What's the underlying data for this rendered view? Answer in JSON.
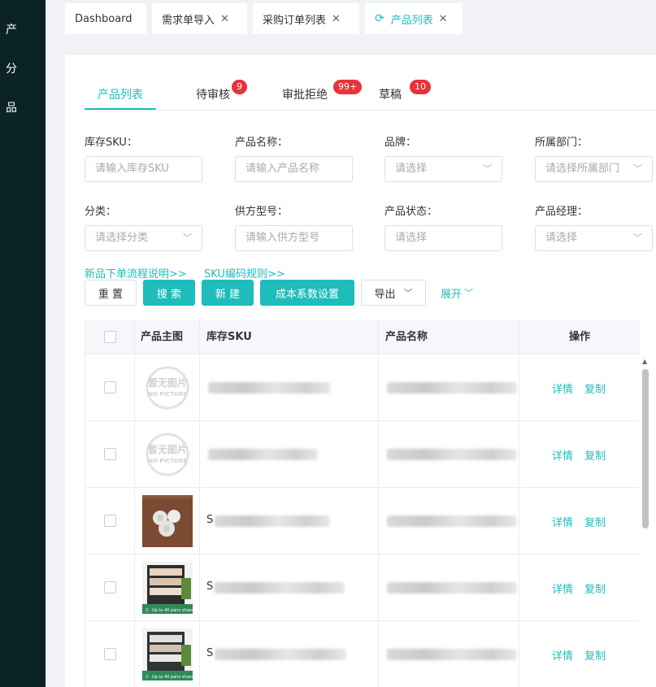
{
  "sidebar": {
    "items": [
      "产",
      "分",
      "品"
    ]
  },
  "tabs": [
    {
      "label": "Dashboard",
      "closable": false
    },
    {
      "label": "需求单导入",
      "closable": true
    },
    {
      "label": "采购订单列表",
      "closable": true
    },
    {
      "label": "产品列表",
      "closable": true,
      "active": true
    }
  ],
  "subtabs": [
    {
      "label": "产品列表",
      "active": true
    },
    {
      "label": "待审核",
      "badge": "9"
    },
    {
      "label": "审批拒绝",
      "badge": "99+"
    },
    {
      "label": "草稿",
      "badge": "10"
    }
  ],
  "filters": {
    "sku": {
      "label": "库存SKU：",
      "placeholder": "请输入库存SKU"
    },
    "name": {
      "label": "产品名称：",
      "placeholder": "请输入产品名称"
    },
    "brand": {
      "label": "品牌：",
      "placeholder": "请选择"
    },
    "dept": {
      "label": "所属部门：",
      "placeholder": "请选择所属部门"
    },
    "category": {
      "label": "分类：",
      "placeholder": "请选择分类"
    },
    "model": {
      "label": "供方型号：",
      "placeholder": "请输入供方型号"
    },
    "status": {
      "label": "产品状态：",
      "placeholder": "请选择"
    },
    "manager": {
      "label": "产品经理：",
      "placeholder": "请选择"
    }
  },
  "links": {
    "flow": "新品下单流程说明>>",
    "sku_rule": "SKU编码规则>>"
  },
  "buttons": {
    "reset": "重 置",
    "search": "搜 索",
    "create": "新 建",
    "cost": "成本系数设置",
    "export": "导出",
    "expand": "展开"
  },
  "table": {
    "columns": [
      "产品主图",
      "库存SKU",
      "产品名称",
      "操作"
    ],
    "no_picture": {
      "cn": "暂无图片",
      "en": "NO PICTURE"
    },
    "rows": [
      {
        "image": "none",
        "sku_prefix": "",
        "actions": [
          "详情",
          "复制"
        ]
      },
      {
        "image": "none",
        "sku_prefix": "",
        "actions": [
          "详情",
          "复制"
        ]
      },
      {
        "image": "round",
        "sku_prefix": "S",
        "actions": [
          "详情",
          "复制"
        ]
      },
      {
        "image": "shelf",
        "sku_prefix": "S",
        "actions": [
          "详情",
          "复制"
        ]
      },
      {
        "image": "shelf",
        "sku_prefix": "S",
        "actions": [
          "详情",
          "复制"
        ]
      }
    ]
  },
  "colors": {
    "accent": "#1fbcbc",
    "badge": "#e9323a",
    "sidebar": "#0b2326"
  }
}
